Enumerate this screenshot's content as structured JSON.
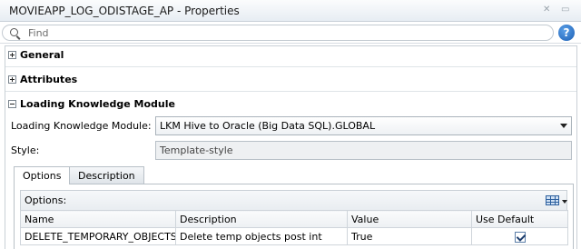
{
  "window": {
    "title": "MOVIEAPP_LOG_ODISTAGE_AP - Properties"
  },
  "search": {
    "placeholder": "Find"
  },
  "sections": {
    "general": "General",
    "attributes": "Attributes",
    "lkm": "Loading Knowledge Module"
  },
  "lkm": {
    "module_label": "Loading Knowledge Module:",
    "module_value": "LKM Hive to Oracle (Big Data SQL).GLOBAL",
    "style_label": "Style:",
    "style_value": "Template-style"
  },
  "tabs": [
    "Options",
    "Description"
  ],
  "options": {
    "header": "Options:",
    "columns": [
      "Name",
      "Description",
      "Value",
      "Use Default"
    ],
    "rows": [
      {
        "name": "DELETE_TEMPORARY_OBJECTS",
        "description": "Delete temp objects post int",
        "value": "True",
        "use_default": true
      }
    ]
  }
}
